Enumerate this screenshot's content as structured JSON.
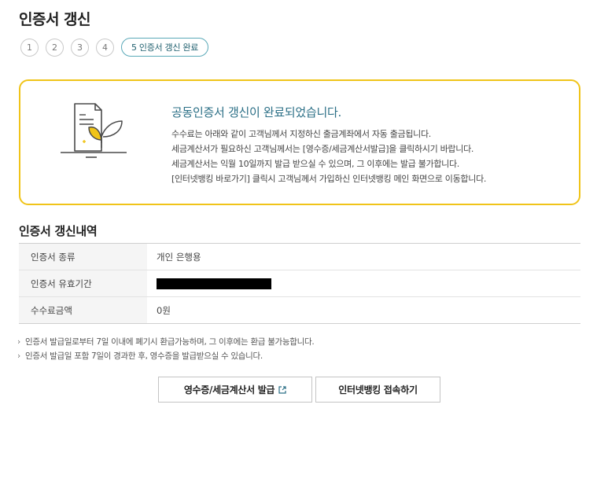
{
  "page": {
    "title": "인증서 갱신"
  },
  "steps": {
    "items": [
      "1",
      "2",
      "3",
      "4"
    ],
    "current_label": "5 인증서 갱신 완료"
  },
  "notice": {
    "title": "공동인증서 갱신이 완료되었습니다.",
    "lines": [
      "수수료는 아래와 같이 고객님께서 지정하신 출금계좌에서 자동 출금됩니다.",
      "세금계산서가 필요하신 고객님께서는 [영수증/세금계산서발급]을 클릭하시기 바랍니다.",
      "세금계산서는 익월 10일까지 발급 받으실 수 있으며, 그 이후에는 발급 불가합니다.",
      "[인터넷뱅킹 바로가기] 클릭시 고객님께서 가입하신 인터넷뱅킹 메인 화면으로 이동합니다."
    ]
  },
  "details": {
    "title": "인증서 갱신내역",
    "rows": [
      {
        "label": "인증서 종류",
        "value": "개인 은행용"
      },
      {
        "label": "인증서 유효기간",
        "value": ""
      },
      {
        "label": "수수료금액",
        "value": "0원"
      }
    ]
  },
  "notes": {
    "bullet": "›",
    "items": [
      "인증서 발급일로부터 7일 이내에 폐기시 환급가능하며, 그 이후에는 환급 불가능합니다.",
      "인증서 발급일 포함 7일이 경과한 후, 영수증을 발급받으실 수 있습니다."
    ]
  },
  "buttons": {
    "receipt": "영수증/세금계산서 발급",
    "bank": "인터넷뱅킹 접속하기"
  },
  "colors": {
    "accent_yellow": "#f0c419",
    "title_teal": "#2b6f86",
    "step_border": "#5aa9b8"
  },
  "icons": {
    "notice": "certificate-sprout-icon",
    "external": "external-link-icon"
  }
}
